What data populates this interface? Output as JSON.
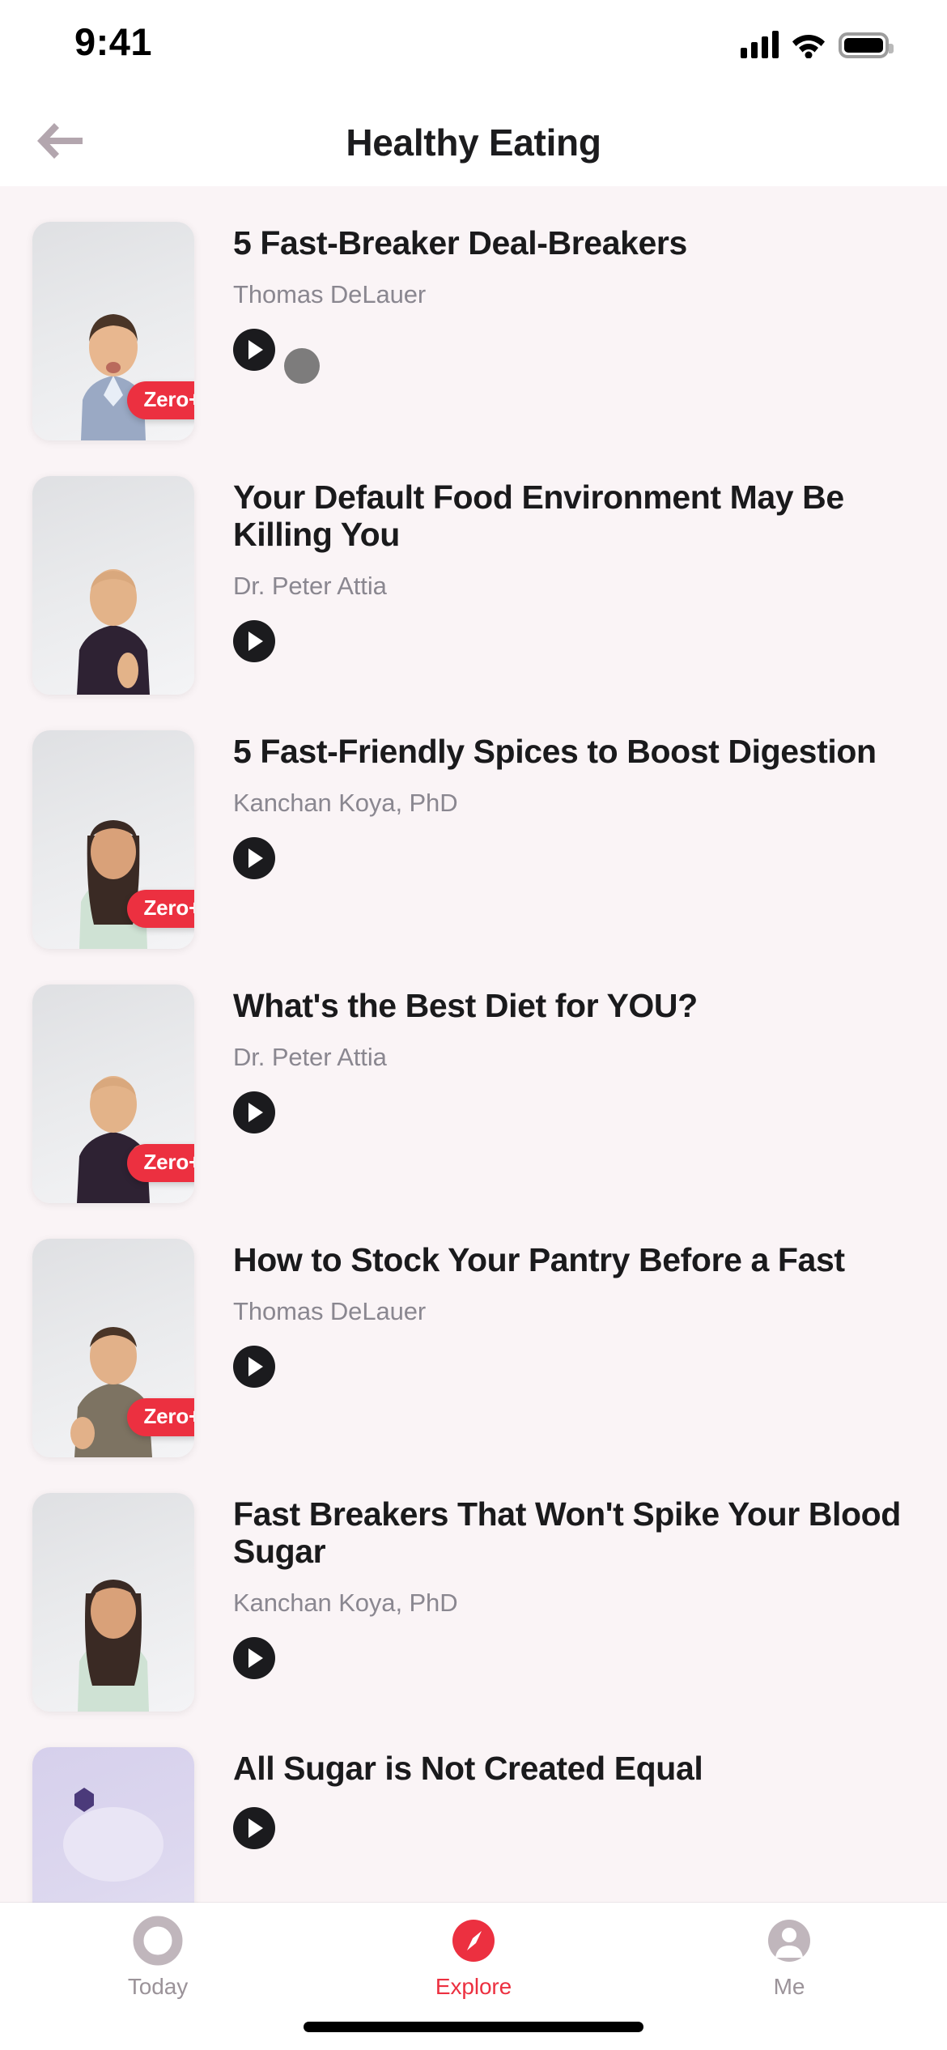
{
  "status_bar": {
    "time": "9:41",
    "signal_icon": "cellular-signal-icon",
    "wifi_icon": "wifi-icon",
    "battery_icon": "battery-full-icon"
  },
  "header": {
    "back_icon": "arrow-left-icon",
    "title": "Healthy Eating"
  },
  "accent_color": "#ec3040",
  "badge_label": "Zero+",
  "list": [
    {
      "title": "5 Fast-Breaker Deal-Breakers",
      "author": "Thomas DeLauer",
      "badge": "Zero+",
      "has_badge": true,
      "play_icon": "play-circle-icon"
    },
    {
      "title": "Your Default Food Environment May Be Killing You",
      "author": "Dr. Peter Attia",
      "badge": "",
      "has_badge": false,
      "play_icon": "play-circle-icon"
    },
    {
      "title": "5 Fast-Friendly Spices to Boost Digestion",
      "author": "Kanchan Koya, PhD",
      "badge": "Zero+",
      "has_badge": true,
      "play_icon": "play-circle-icon"
    },
    {
      "title": "What's the Best Diet for YOU?",
      "author": "Dr. Peter Attia",
      "badge": "Zero+",
      "has_badge": true,
      "play_icon": "play-circle-icon"
    },
    {
      "title": "How to Stock Your Pantry Before a Fast",
      "author": "Thomas DeLauer",
      "badge": "Zero+",
      "has_badge": true,
      "play_icon": "play-circle-icon"
    },
    {
      "title": "Fast Breakers That Won't Spike Your Blood Sugar",
      "author": "Kanchan Koya, PhD",
      "badge": "",
      "has_badge": false,
      "play_icon": "play-circle-icon"
    },
    {
      "title": "All Sugar is Not Created Equal",
      "author": "",
      "badge": "",
      "has_badge": false,
      "play_icon": "play-circle-icon"
    }
  ],
  "tab_bar": {
    "items": [
      {
        "label": "Today",
        "icon": "ring-circle-icon",
        "active": false
      },
      {
        "label": "Explore",
        "icon": "compass-icon",
        "active": true
      },
      {
        "label": "Me",
        "icon": "person-icon",
        "active": false
      }
    ]
  }
}
